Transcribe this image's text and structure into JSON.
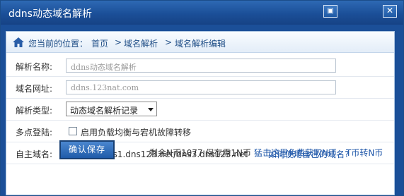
{
  "window": {
    "title": "ddns动态域名解析"
  },
  "titlebar_buttons": {
    "restore": "▣",
    "close": "✕"
  },
  "breadcrumb": {
    "here": "您当前的位置：",
    "home": "首页",
    "sep": ">",
    "parse": "域名解析",
    "edit": "域名解析编辑"
  },
  "form": {
    "name_label": "解析名称:",
    "name_placeholder": "ddns动态域名解析",
    "url_label": "域名网址:",
    "url_placeholder": "ddns.123nat.com",
    "type_label": "解析类型:",
    "type_value": "动态域名解析记录",
    "multi_label": "多点登陆:",
    "multi_checkbox_label": "启用负载均衡与宕机故障转移",
    "own_label": "自主域名:",
    "own_dns": "dns或ns:dns1.dns123.net/dns3.dns123.net",
    "own_link": "如何使用自己的域名?"
  },
  "footer": {
    "save_label": "确认保存",
    "balance": "剩余N币1077 保存需1N币",
    "free_link": "猛击这里免费获取N币",
    "convert_link": "T币转N币"
  },
  "colors": {
    "title_bar": "#1b4f98",
    "link": "#1c55a8",
    "save_button": "#1f5ba9"
  }
}
